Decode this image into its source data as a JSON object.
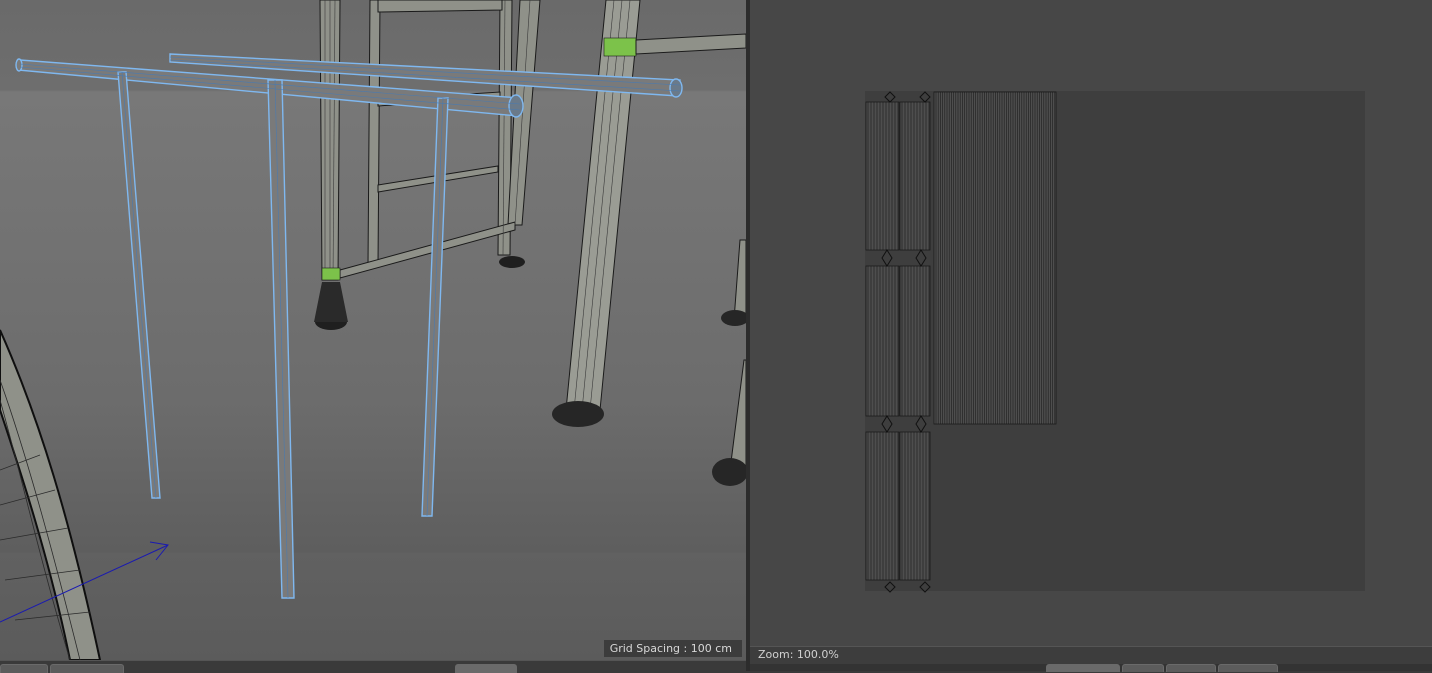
{
  "viewport": {
    "grid_spacing_label": "Grid Spacing : 100 cm"
  },
  "uv_editor": {
    "zoom_label": "Zoom: 100.0%"
  },
  "colors": {
    "selection_wire": "#7fb8f0",
    "object_wire": "#1e1e1e",
    "highlight_green": "#7cc24a",
    "axis_blue": "#1a1ab0"
  }
}
